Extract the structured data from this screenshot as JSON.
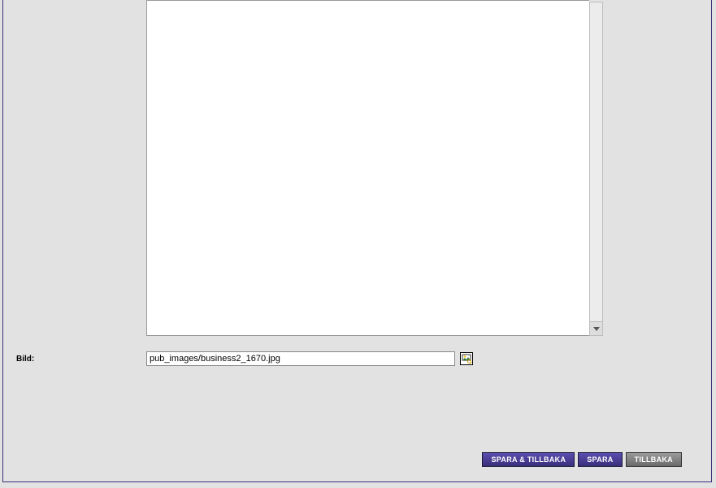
{
  "form": {
    "bild_label": "Bild:",
    "bild_value": "pub_images/business2_1670.jpg"
  },
  "buttons": {
    "save_back": "SPARA & TILLBAKA",
    "save": "SPARA",
    "back": "TILLBAKA"
  }
}
